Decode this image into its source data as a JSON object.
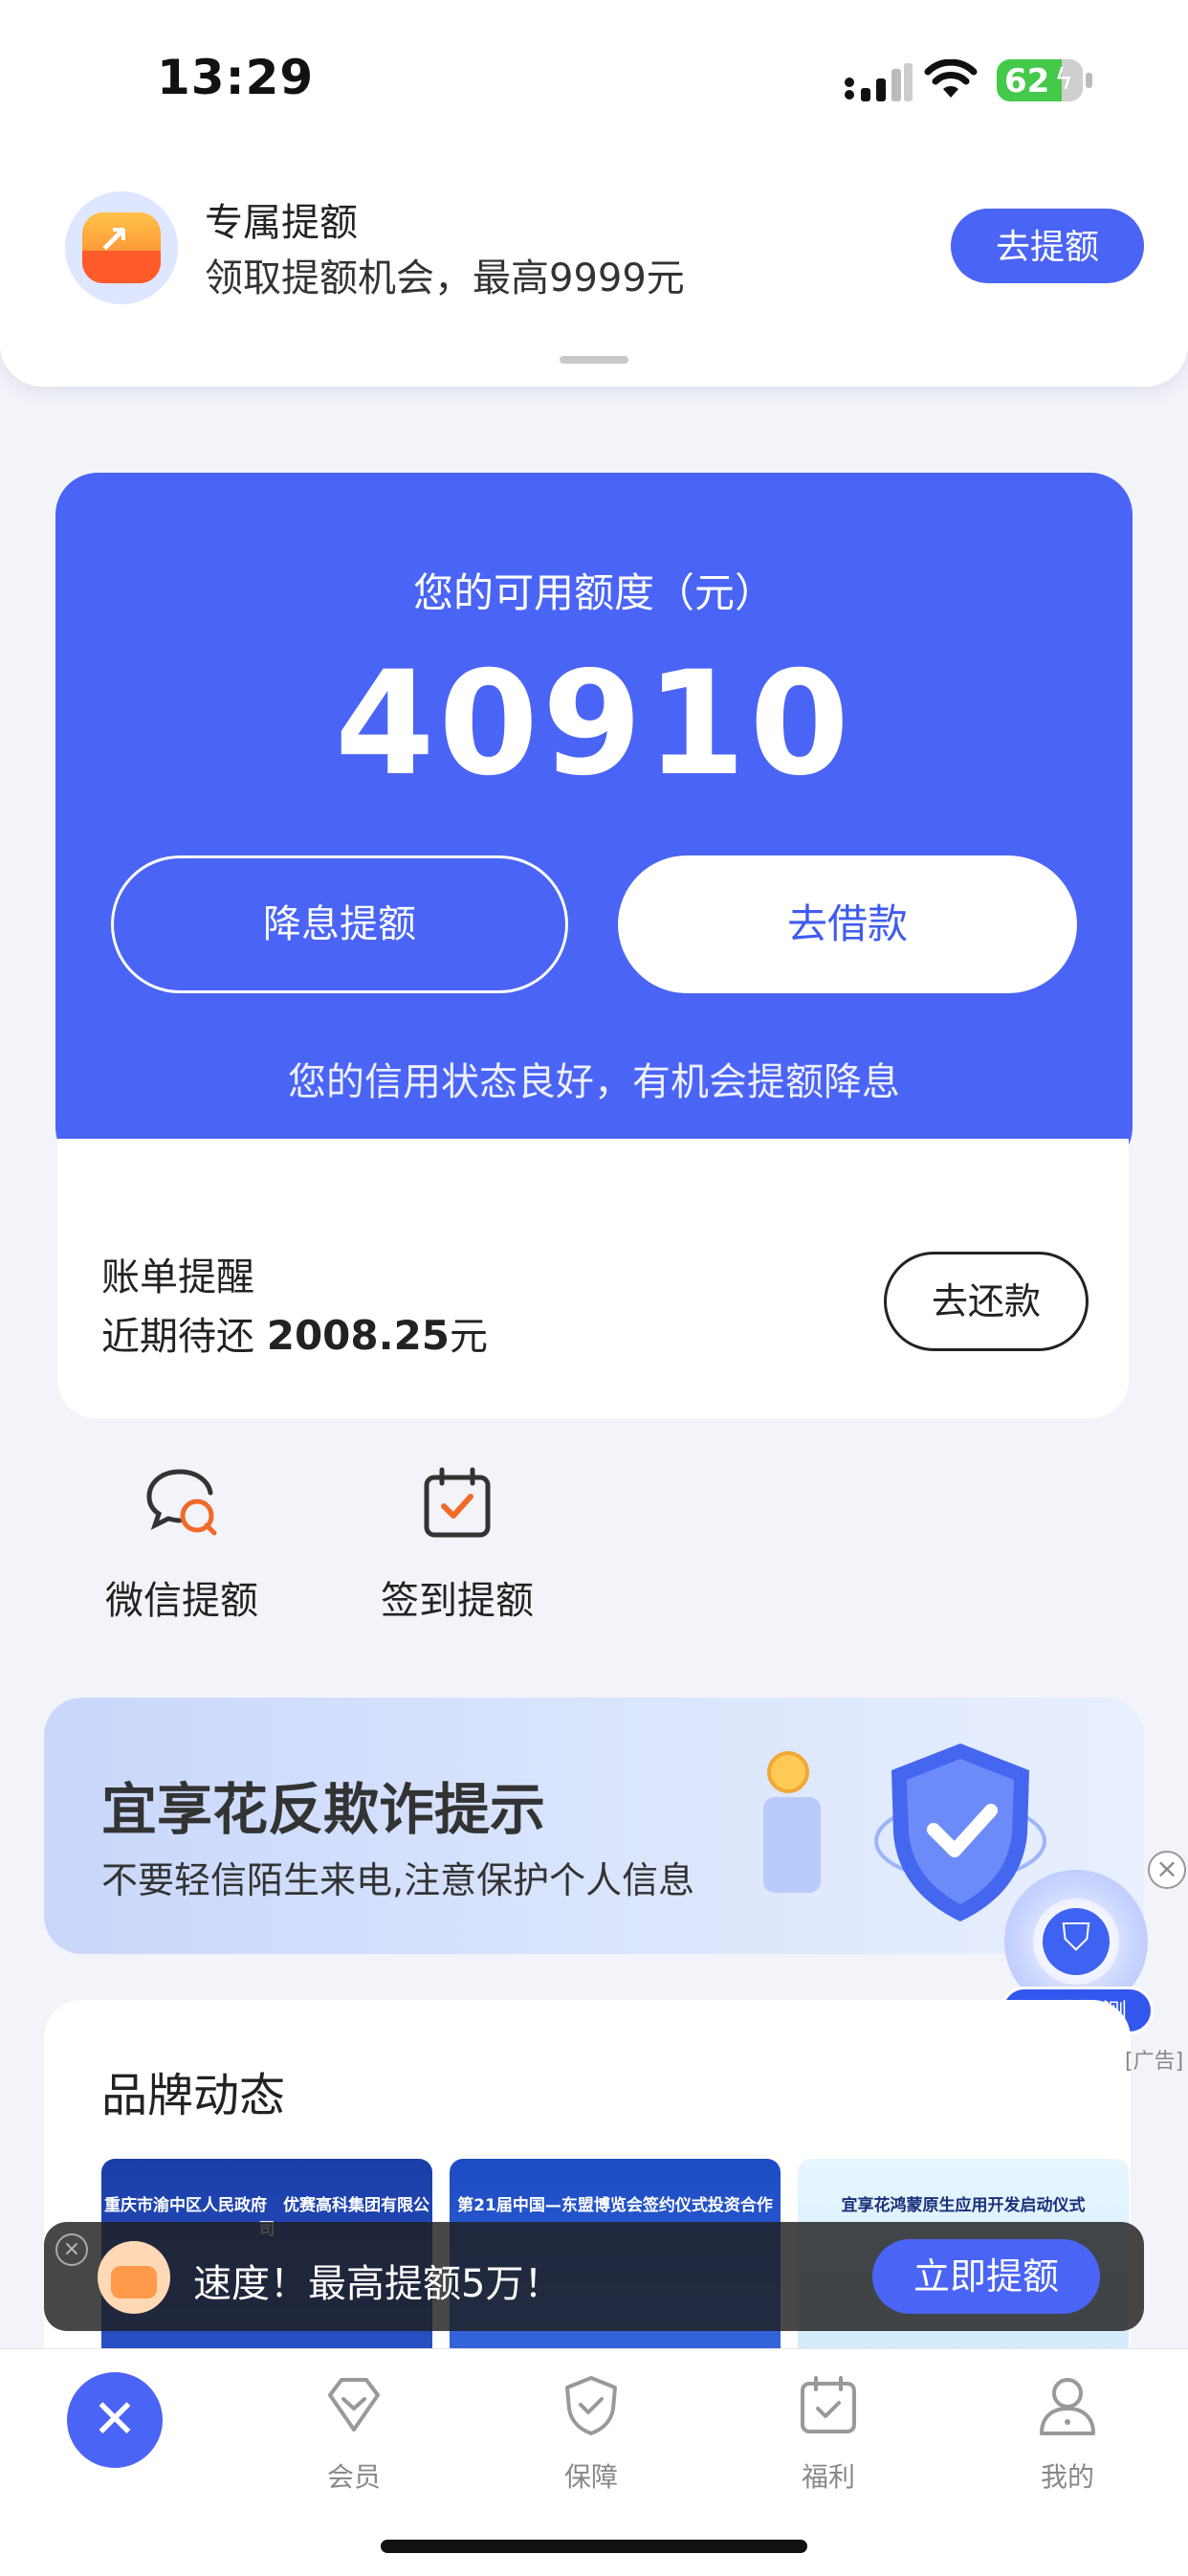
{
  "status_bar": {
    "time": "13:29",
    "battery": "62"
  },
  "promo": {
    "title": "专属提额",
    "subtitle": "领取提额机会，最高9999元",
    "button": "去提额"
  },
  "credit": {
    "label": "您的可用额度（元）",
    "amount": "40910",
    "btn_reduce": "降息提额",
    "btn_borrow": "去借款",
    "tip": "您的信用状态良好，有机会提额降息"
  },
  "bill": {
    "title": "账单提醒",
    "prefix": "近期待还 ",
    "amount": "2008.25",
    "unit": "元",
    "button": "去还款"
  },
  "quick": [
    {
      "label": "微信提额",
      "icon": "wechat-chat-icon"
    },
    {
      "label": "签到提额",
      "icon": "calendar-check-icon"
    }
  ],
  "fraud": {
    "title": "宜享花反欺诈提示",
    "subtitle": "不要轻信陌生来电,注意保护个人信息"
  },
  "risk": {
    "label": "风险监测",
    "ad_tag": "[广告]"
  },
  "brand": {
    "title": "品牌动态",
    "news": [
      {
        "caption": "重庆市渝中区人民政府　优赛高科集团有限公司"
      },
      {
        "caption": "第21届中国—东盟博览会签约仪式投资合作"
      },
      {
        "caption": "宜享花鸿蒙原生应用开发启动仪式"
      }
    ]
  },
  "toast": {
    "text": "速度！最高提额5万！",
    "button": "立即提额"
  },
  "tabs": [
    {
      "label": "会员",
      "icon": "member-badge-icon"
    },
    {
      "label": "保障",
      "icon": "shield-check-icon"
    },
    {
      "label": "福利",
      "icon": "calendar-check-icon"
    },
    {
      "label": "我的",
      "icon": "user-icon"
    }
  ],
  "colors": {
    "primary": "#4a64f5",
    "background": "#f3f4fa",
    "battery": "#45c94a"
  }
}
